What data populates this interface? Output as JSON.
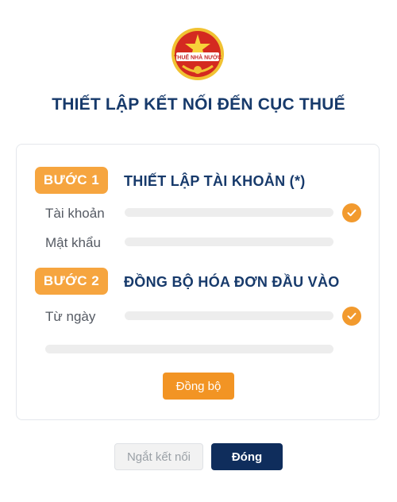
{
  "header": {
    "emblem_text": "THUẾ NHÀ NƯỚC",
    "title": "THIẾT LẬP KẾT NỐI ĐẾN CỤC THUẾ"
  },
  "step1": {
    "badge": "BƯỚC 1",
    "title": "THIẾT LẬP TÀI KHOẢN (*)",
    "fields": [
      {
        "label": "Tài khoản",
        "value": "",
        "verified": true
      },
      {
        "label": "Mật khẩu",
        "value": "",
        "verified": false
      }
    ]
  },
  "step2": {
    "badge": "BƯỚC 2",
    "title": "ĐỒNG BỘ HÓA ĐƠN ĐẦU VÀO",
    "fields": [
      {
        "label": "Từ ngày",
        "value": "",
        "verified": true
      }
    ],
    "sync_button": "Đồng bộ"
  },
  "footer": {
    "disconnect_label": "Ngắt kết nối",
    "close_label": "Đóng"
  },
  "colors": {
    "accent_orange": "#f29424",
    "navy": "#173a6b",
    "close_button": "#0f2d5c"
  }
}
